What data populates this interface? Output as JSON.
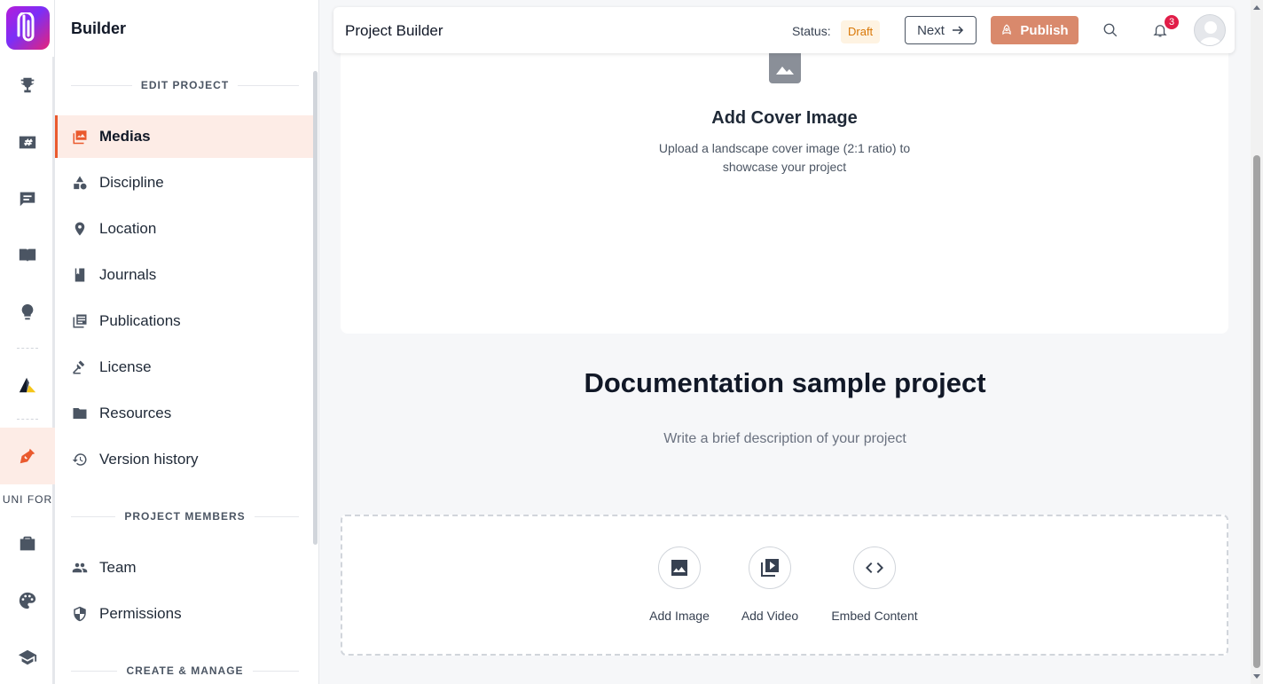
{
  "sidebar": {
    "title": "Builder",
    "sections": {
      "edit_project": "EDIT PROJECT",
      "project_members": "PROJECT MEMBERS",
      "create_manage": "CREATE & MANAGE"
    },
    "items": [
      {
        "label": "Medias",
        "icon": "media-icon",
        "active": true
      },
      {
        "label": "Discipline",
        "icon": "shapes-icon"
      },
      {
        "label": "Location",
        "icon": "location-pin-icon"
      },
      {
        "label": "Journals",
        "icon": "journal-book-icon"
      },
      {
        "label": "Publications",
        "icon": "publications-icon"
      },
      {
        "label": "License",
        "icon": "gavel-icon"
      },
      {
        "label": "Resources",
        "icon": "folder-icon"
      },
      {
        "label": "Version history",
        "icon": "history-icon"
      }
    ],
    "member_items": [
      {
        "label": "Team",
        "icon": "people-icon"
      },
      {
        "label": "Permissions",
        "icon": "shield-icon"
      }
    ]
  },
  "rail": {
    "label": "UNI FOR",
    "icons": [
      "trophy-icon",
      "hashtag-card-icon",
      "message-icon",
      "book-open-icon",
      "lightbulb-icon",
      "triangle-logo-icon",
      "pen-nib-icon",
      "briefcase-icon",
      "palette-icon",
      "graduation-cap-icon"
    ]
  },
  "topbar": {
    "title": "Project Builder",
    "status_label": "Status:",
    "status_value": "Draft",
    "next_label": "Next",
    "publish_label": "Publish",
    "notification_count": "3"
  },
  "cover": {
    "title": "Add Cover Image",
    "subtitle": "Upload a landscape cover image (2:1 ratio) to showcase your project"
  },
  "project": {
    "title": "Documentation sample project",
    "description_placeholder": "Write a brief description of your project"
  },
  "media_actions": {
    "add_image": "Add Image",
    "add_video": "Add Video",
    "embed": "Embed Content"
  },
  "colors": {
    "accent": "#ea5a2e",
    "publish_button": "#d9896c",
    "draft_badge_text": "#d97706",
    "draft_badge_bg": "#fef3e2",
    "notification_badge": "#e11d48"
  }
}
